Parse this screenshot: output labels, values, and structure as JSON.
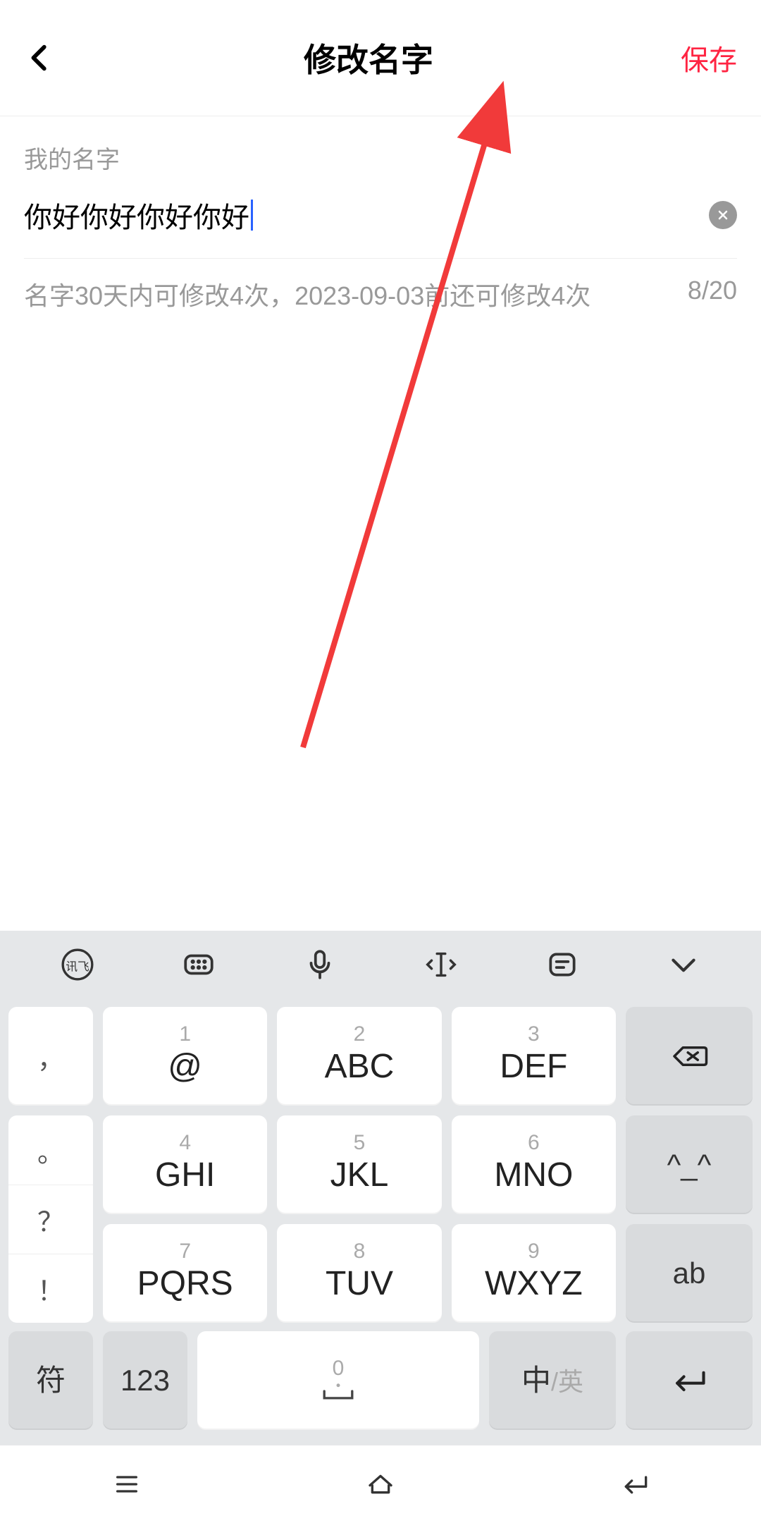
{
  "header": {
    "title": "修改名字",
    "save_label": "保存"
  },
  "form": {
    "label": "我的名字",
    "value": "你好你好你好你好",
    "hint": "名字30天内可修改4次，2023-09-03前还可修改4次",
    "counter": "8/20"
  },
  "keyboard": {
    "toolbar": [
      "xunfei",
      "keyboard-mini",
      "mic",
      "text-select",
      "clipboard",
      "chevron-down"
    ],
    "keys": {
      "k1": {
        "num": "1",
        "main": "@"
      },
      "k2": {
        "num": "2",
        "main": "ABC"
      },
      "k3": {
        "num": "3",
        "main": "DEF"
      },
      "k4": {
        "num": "4",
        "main": "GHI"
      },
      "k5": {
        "num": "5",
        "main": "JKL"
      },
      "k6": {
        "num": "6",
        "main": "MNO"
      },
      "k7": {
        "num": "7",
        "main": "PQRS"
      },
      "k8": {
        "num": "8",
        "main": "TUV"
      },
      "k9": {
        "num": "9",
        "main": "WXYZ"
      }
    },
    "left_side": {
      "a": "，",
      "b": "。",
      "c": "？",
      "d": "！"
    },
    "right_side": {
      "emoji": "^_^",
      "ab": "ab"
    },
    "bottom": {
      "sym": "符",
      "num": "123",
      "space_num": "0",
      "lang_zh": "中",
      "lang_en": "/英"
    }
  }
}
